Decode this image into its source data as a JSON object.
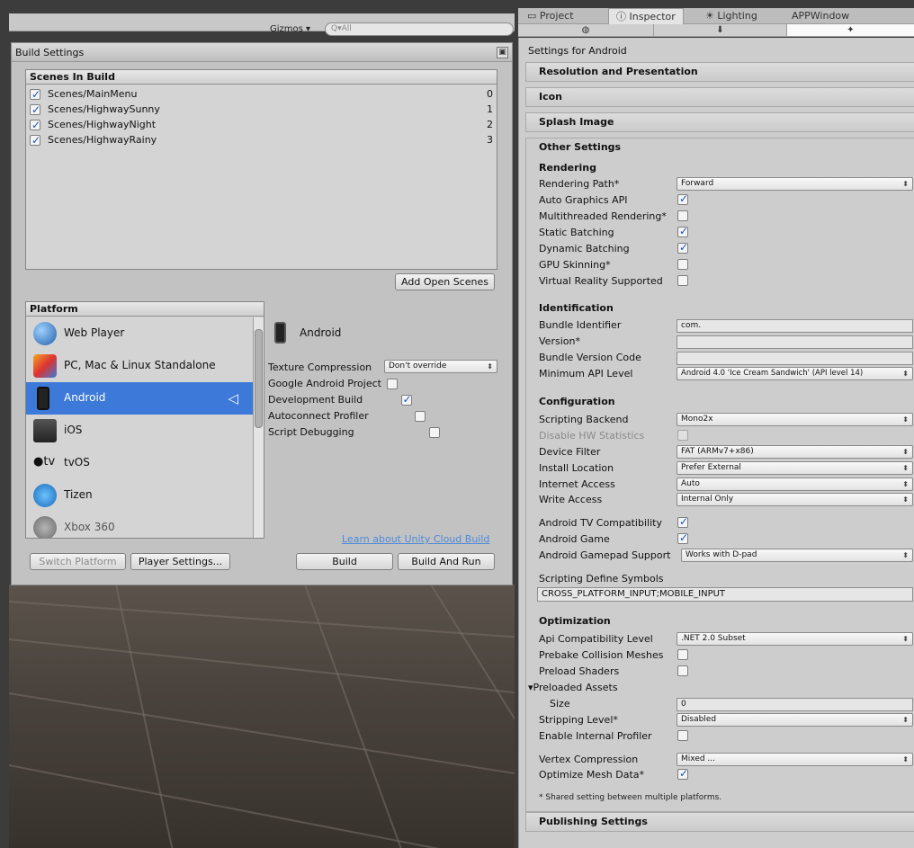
{
  "inspector_tabs": {
    "project": "Project",
    "inspector": "Inspector",
    "lighting": "Lighting",
    "appwindow": "APPWindow"
  },
  "scene_toolbar": {
    "gizmos": "Gizmos",
    "search_placeholder": "Q▾All"
  },
  "build_settings": {
    "title": "Build Settings",
    "scenes_header": "Scenes In Build",
    "scenes": [
      {
        "name": "Scenes/MainMenu",
        "index": "0",
        "checked": true
      },
      {
        "name": "Scenes/HighwaySunny",
        "index": "1",
        "checked": true
      },
      {
        "name": "Scenes/HighwayNight",
        "index": "2",
        "checked": true
      },
      {
        "name": "Scenes/HighwayRainy",
        "index": "3",
        "checked": true
      }
    ],
    "add_open_scenes": "Add Open Scenes",
    "platform_header": "Platform",
    "platforms": [
      {
        "label": "Web Player",
        "icon": "globe-icon"
      },
      {
        "label": "PC, Mac & Linux Standalone",
        "icon": "standalone-icon"
      },
      {
        "label": "Android",
        "icon": "android-phone-icon",
        "selected": true
      },
      {
        "label": "iOS",
        "icon": "ios-device-icon"
      },
      {
        "label": "tvOS",
        "icon": "appletv-icon"
      },
      {
        "label": "Tizen",
        "icon": "tizen-icon"
      },
      {
        "label": "Xbox 360",
        "icon": "xbox-icon"
      }
    ],
    "selected_platform": "Android",
    "texture_compression_label": "Texture Compression",
    "texture_compression_value": "Don't override",
    "google_android_project": "Google Android Project",
    "development_build": "Development Build",
    "autoconnect_profiler": "Autoconnect Profiler",
    "script_debugging": "Script Debugging",
    "cloud_build_link": "Learn about Unity Cloud Build",
    "switch_platform": "Switch Platform",
    "player_settings": "Player Settings...",
    "build": "Build",
    "build_and_run": "Build And Run"
  },
  "inspector": {
    "settings_for": "Settings for Android",
    "sections": {
      "resolution": "Resolution and Presentation",
      "icon": "Icon",
      "splash": "Splash Image",
      "other": "Other Settings",
      "publishing": "Publishing Settings"
    },
    "rendering": {
      "header": "Rendering",
      "rendering_path": "Rendering Path*",
      "rendering_path_value": "Forward",
      "auto_graphics_api": "Auto Graphics API",
      "multithreaded": "Multithreaded Rendering*",
      "static_batching": "Static Batching",
      "dynamic_batching": "Dynamic Batching",
      "gpu_skinning": "GPU Skinning*",
      "vr_supported": "Virtual Reality Supported"
    },
    "identification": {
      "header": "Identification",
      "bundle_identifier": "Bundle Identifier",
      "bundle_identifier_value": "com.",
      "version": "Version*",
      "bundle_version_code": "Bundle Version Code",
      "min_api_level": "Minimum API Level",
      "min_api_level_value": "Android 4.0 'Ice Cream Sandwich' (API level 14)"
    },
    "configuration": {
      "header": "Configuration",
      "scripting_backend": "Scripting Backend",
      "scripting_backend_value": "Mono2x",
      "disable_hw_stats": "Disable HW Statistics",
      "device_filter": "Device Filter",
      "device_filter_value": "FAT (ARMv7+x86)",
      "install_location": "Install Location",
      "install_location_value": "Prefer External",
      "internet_access": "Internet Access",
      "internet_access_value": "Auto",
      "write_access": "Write Access",
      "write_access_value": "Internal Only",
      "android_tv": "Android TV Compatibility",
      "android_game": "Android Game",
      "gamepad_support": "Android Gamepad Support",
      "gamepad_support_value": "Works with D-pad",
      "define_symbols": "Scripting Define Symbols",
      "define_symbols_value": "CROSS_PLATFORM_INPUT;MOBILE_INPUT"
    },
    "optimization": {
      "header": "Optimization",
      "api_compat": "Api Compatibility Level",
      "api_compat_value": ".NET 2.0 Subset",
      "prebake": "Prebake Collision Meshes",
      "preload_shaders": "Preload Shaders",
      "preloaded_assets": "Preloaded Assets",
      "size": "Size",
      "size_value": "0",
      "stripping": "Stripping Level*",
      "stripping_value": "Disabled",
      "internal_profiler": "Enable Internal Profiler",
      "vertex_compression": "Vertex Compression",
      "vertex_compression_value": "Mixed ...",
      "optimize_mesh": "Optimize Mesh Data*",
      "shared_note": "* Shared setting between multiple platforms."
    }
  },
  "colors": {
    "selection": "#3d79d8",
    "link": "#4c8ad9",
    "panel": "#c2c2c2"
  }
}
